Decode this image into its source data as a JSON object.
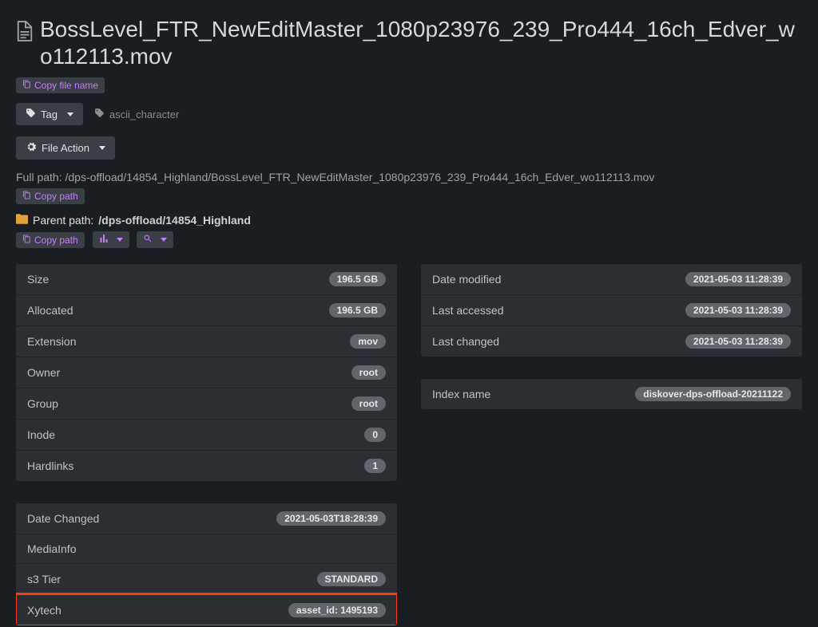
{
  "title": "BossLevel_FTR_NewEditMaster_1080p23976_239_Pro444_16ch_Edver_wo112113.mov",
  "actions": {
    "copy_file_name": "Copy file name",
    "tag": "Tag",
    "existing_tag": "ascii_character",
    "file_action": "File Action",
    "copy_path": "Copy path"
  },
  "full_path": {
    "label": "Full path:",
    "value": "/dps-offload/14854_Highland/BossLevel_FTR_NewEditMaster_1080p23976_239_Pro444_16ch_Edver_wo112113.mov"
  },
  "parent_path": {
    "label": "Parent path:",
    "value": "/dps-offload/14854_Highland"
  },
  "left_a": [
    {
      "label": "Size",
      "value": "196.5 GB"
    },
    {
      "label": "Allocated",
      "value": "196.5 GB"
    },
    {
      "label": "Extension",
      "value": "mov"
    },
    {
      "label": "Owner",
      "value": "root"
    },
    {
      "label": "Group",
      "value": "root"
    },
    {
      "label": "Inode",
      "value": "0"
    },
    {
      "label": "Hardlinks",
      "value": "1"
    }
  ],
  "left_b": [
    {
      "label": "Date Changed",
      "value": "2021-05-03T18:28:39"
    },
    {
      "label": "MediaInfo",
      "value": ""
    },
    {
      "label": "s3 Tier",
      "value": "STANDARD"
    },
    {
      "label": "Xytech",
      "value": "asset_id: 1495193",
      "highlight": true
    }
  ],
  "right_a": [
    {
      "label": "Date modified",
      "value": "2021-05-03 11:28:39"
    },
    {
      "label": "Last accessed",
      "value": "2021-05-03 11:28:39"
    },
    {
      "label": "Last changed",
      "value": "2021-05-03 11:28:39"
    }
  ],
  "right_b": [
    {
      "label": "Index name",
      "value": "diskover-dps-offload-20211122"
    }
  ]
}
